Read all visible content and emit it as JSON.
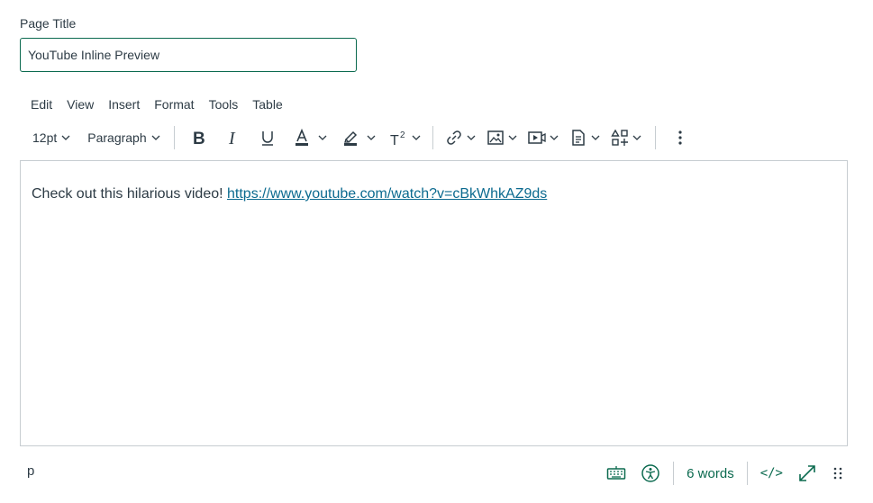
{
  "form": {
    "title_label": "Page Title",
    "title_value": "YouTube Inline Preview"
  },
  "menubar": {
    "items": [
      "Edit",
      "View",
      "Insert",
      "Format",
      "Tools",
      "Table"
    ]
  },
  "toolbar": {
    "font_size": "12pt",
    "block_format": "Paragraph",
    "icons": [
      "bold-icon",
      "italic-icon",
      "underline-icon",
      "text-color-icon",
      "highlight-icon",
      "superscript-icon",
      "link-icon",
      "image-icon",
      "media-icon",
      "document-icon",
      "apps-icon",
      "more-icon"
    ]
  },
  "editor": {
    "text": "Check out this hilarious video! ",
    "link_text": "https://www.youtube.com/watch?v=cBkWhkAZ9ds"
  },
  "statusbar": {
    "path": "p",
    "word_count": "6 words",
    "html_toggle": "</>"
  },
  "colors": {
    "accent": "#0b6a4f",
    "link": "#0b6a8f",
    "text": "#2d3b45",
    "border": "#c7cdd1"
  }
}
